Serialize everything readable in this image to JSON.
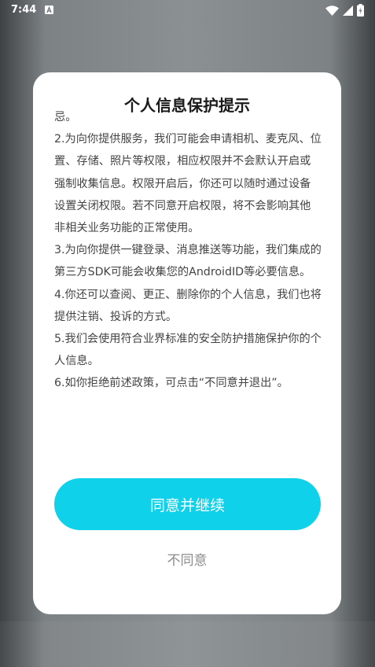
{
  "status_bar": {
    "time": "7:44",
    "notification_icon": "a-icon",
    "icons": [
      "wifi-icon",
      "cell-signal-icon",
      "battery-icon"
    ]
  },
  "dialog": {
    "title": "个人信息保护提示",
    "paragraphs": [
      "忌。",
      "2.为向你提供服务，我们可能会申请相机、麦克风、位置、存储、照片等权限，相应权限并不会默认开启或强制收集信息。权限开启后，你还可以随时通过设备设置关闭权限。若不同意开启权限，将不会影响其他非相关业务功能的正常使用。",
      "3.为向你提供一键登录、消息推送等功能，我们集成的第三方SDK可能会收集您的AndroidID等必要信息。",
      "4.你还可以查阅、更正、删除你的个人信息，我们也将提供注销、投诉的方式。",
      "5.我们会使用符合业界标准的安全防护措施保护你的个人信息。",
      "6.如你拒绝前述政策，可点击“不同意并退出”。"
    ],
    "agree_label": "同意并继续",
    "disagree_label": "不同意"
  },
  "colors": {
    "accent": "#0fd1ea",
    "dialog_bg": "#ffffff",
    "text": "#444444",
    "muted": "#8c8c8c"
  }
}
